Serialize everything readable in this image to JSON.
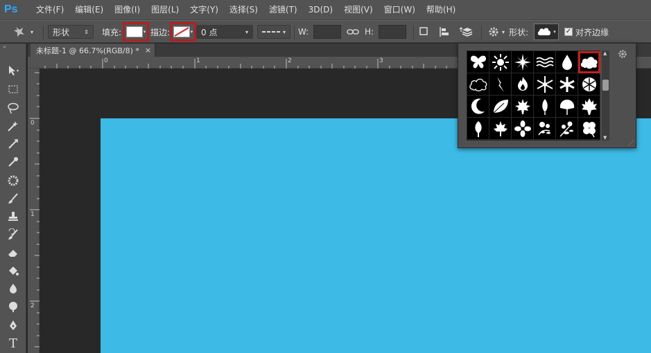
{
  "app": {
    "logo": "Ps"
  },
  "menu": [
    "文件(F)",
    "编辑(E)",
    "图像(I)",
    "图层(L)",
    "文字(Y)",
    "选择(S)",
    "滤镜(T)",
    "3D(D)",
    "视图(V)",
    "窗口(W)",
    "帮助(H)"
  ],
  "options": {
    "mode": "形状",
    "fill_label": "填充:",
    "stroke_label": "描边:",
    "stroke_width": "0 点",
    "w_label": "W:",
    "h_label": "H:",
    "shape_label": "形状:",
    "align_edges": "对齐边缘",
    "align_checked": true
  },
  "document": {
    "tab_title": "未标题-1 @ 66.7%(RGB/8) *",
    "close": "×",
    "canvas_color": "#3dbae6"
  },
  "rulers": {
    "h_ticks": [
      "0",
      "1",
      "2",
      "3"
    ],
    "v_ticks": [
      "0",
      "1",
      "2"
    ]
  },
  "shape_picker": {
    "shapes": [
      "butterfly-shape",
      "sun-shape",
      "sparkle-shape",
      "waves-shape",
      "raindrop-shape",
      "cloud-shape",
      "cloud-outline-shape",
      "lightning-shape",
      "fire-shape",
      "snowflake-shape",
      "snowflake2-shape",
      "snowflake3-shape",
      "moon-shape",
      "leaf-shape",
      "maple-leaf-shape",
      "leaf2-shape",
      "leaf3-shape",
      "maple-leaf2-shape",
      "tree-shape",
      "maple-leaf3-shape",
      "flower-shape",
      "flower2-shape",
      "flower3-shape",
      "clover-shape"
    ],
    "selected": "cloud-shape"
  },
  "colors": {
    "accent_red": "#b61f1f",
    "panel": "#535353"
  }
}
